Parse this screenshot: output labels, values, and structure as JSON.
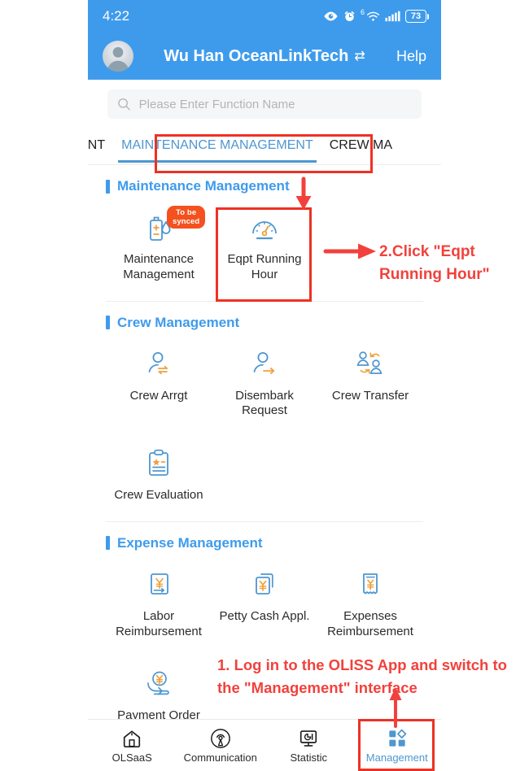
{
  "status_bar": {
    "time": "4:22",
    "battery_level": "73",
    "icons": [
      "eye-icon",
      "alarm-icon",
      "wifi-icon",
      "signal-icon",
      "battery-icon"
    ],
    "network_label": "6"
  },
  "app_bar": {
    "title": "Wu Han OceanLinkTech",
    "switch_icon": "⇄",
    "help_label": "Help",
    "avatar": "user-avatar"
  },
  "search": {
    "placeholder": "Please Enter Function Name",
    "value": "",
    "icon": "search-icon"
  },
  "tabs": [
    {
      "label": "AGEMENT",
      "active": false
    },
    {
      "label": "MAINTENANCE MANAGEMENT",
      "active": true
    },
    {
      "label": "CREW MA",
      "active": false
    }
  ],
  "sections": [
    {
      "title": "Maintenance Management",
      "items": [
        {
          "label": "Maintenance Management",
          "icon": "oil-bottle-icon",
          "badge": "To be synced"
        },
        {
          "label": "Eqpt Running Hour",
          "icon": "gauge-icon",
          "badge": ""
        }
      ]
    },
    {
      "title": "Crew Management",
      "items": [
        {
          "label": "Crew Arrgt",
          "icon": "person-exchange-icon",
          "badge": ""
        },
        {
          "label": "Disembark Request",
          "icon": "person-arrow-icon",
          "badge": ""
        },
        {
          "label": "Crew Transfer",
          "icon": "two-person-transfer-icon",
          "badge": ""
        },
        {
          "label": "Crew Evaluation",
          "icon": "clipboard-star-icon",
          "badge": ""
        }
      ]
    },
    {
      "title": "Expense Management",
      "items": [
        {
          "label": "Labor Reimbursement",
          "icon": "yen-document-arrow-icon",
          "badge": ""
        },
        {
          "label": "Petty Cash Appl.",
          "icon": "yen-copy-icon",
          "badge": ""
        },
        {
          "label": "Expenses Reimbursement",
          "icon": "yen-receipt-icon",
          "badge": ""
        },
        {
          "label": "Payment Order",
          "icon": "yen-hand-icon",
          "badge": ""
        }
      ]
    }
  ],
  "bottom_nav": [
    {
      "label": "OLSaaS",
      "icon": "home-icon",
      "active": false
    },
    {
      "label": "Communication",
      "icon": "broadcast-icon",
      "active": false
    },
    {
      "label": "Statistic",
      "icon": "monitor-chart-icon",
      "active": false
    },
    {
      "label": "Management",
      "icon": "grid-diamond-icon",
      "active": true
    }
  ],
  "annotations": {
    "step1": "1. Log in to the OLISS App and switch to the \"Management\" interface",
    "step2": "2.Click \"Eqpt Running Hour\""
  },
  "colors": {
    "header_blue": "#3e9bec",
    "accent_blue": "#4e97d1",
    "annotation_red": "#f2413c",
    "highlight_box_red": "#ee3124",
    "badge_orange": "#f4511e",
    "icon_orange": "#f0a13c"
  }
}
